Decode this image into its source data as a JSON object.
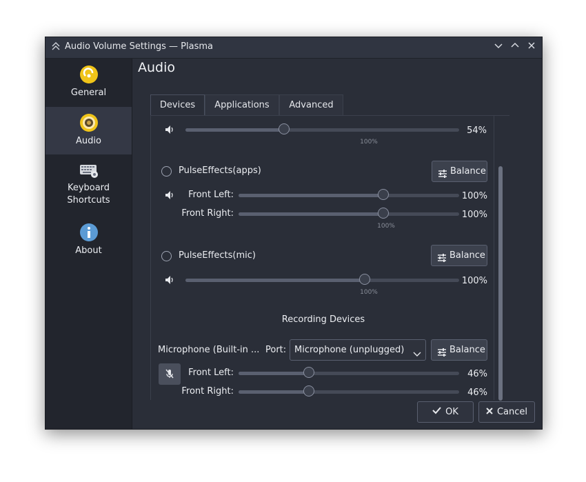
{
  "window": {
    "title": "Audio Volume Settings — Plasma",
    "app_icon": "chevrons-up-icon"
  },
  "titlebar_buttons": [
    "minimize-icon",
    "maximize-icon",
    "close-icon"
  ],
  "sidebar": {
    "items": [
      {
        "label": "General",
        "icon": "general-icon",
        "active": false
      },
      {
        "label": "Audio",
        "icon": "speaker-audio-icon",
        "active": true
      },
      {
        "label": "Keyboard Shortcuts",
        "label_line1": "Keyboard",
        "label_line2": "Shortcuts",
        "icon": "keyboard-icon",
        "active": false
      },
      {
        "label": "About",
        "icon": "info-icon",
        "active": false
      }
    ]
  },
  "page": {
    "title": "Audio"
  },
  "tabs": [
    {
      "label": "Devices",
      "active": true
    },
    {
      "label": "Applications",
      "active": false
    },
    {
      "label": "Advanced",
      "active": false
    }
  ],
  "devices": {
    "top_device": {
      "volume_percent": 54,
      "volume_text": "54%",
      "mark_text": "100%"
    },
    "pulseeffects_apps": {
      "name": "PulseEffects(apps)",
      "balance_label": "Balance",
      "channels": [
        {
          "label": "Front Left:",
          "volume_percent": 100,
          "volume_text": "100%"
        },
        {
          "label": "Front Right:",
          "volume_percent": 100,
          "volume_text": "100%"
        }
      ],
      "mark_text": "100%"
    },
    "pulseeffects_mic": {
      "name": "PulseEffects(mic)",
      "balance_label": "Balance",
      "volume_percent": 100,
      "volume_text": "100%",
      "mark_text": "100%"
    },
    "recording_header": "Recording Devices",
    "microphone": {
      "name": "Microphone (Built-in ...",
      "port_label": "Port:",
      "port_value": "Microphone (unplugged)",
      "balance_label": "Balance",
      "muted": true,
      "channels": [
        {
          "label": "Front Left:",
          "volume_percent": 46,
          "volume_text": "46%"
        },
        {
          "label": "Front Right:",
          "volume_percent": 46,
          "volume_text": "46%"
        }
      ]
    }
  },
  "footer": {
    "ok_label": "OK",
    "cancel_label": "Cancel"
  },
  "colors": {
    "accent": "#3daee9",
    "window_bg": "#2a2e38",
    "sidebar_bg": "#22252d",
    "sidebar_active": "#343845"
  }
}
